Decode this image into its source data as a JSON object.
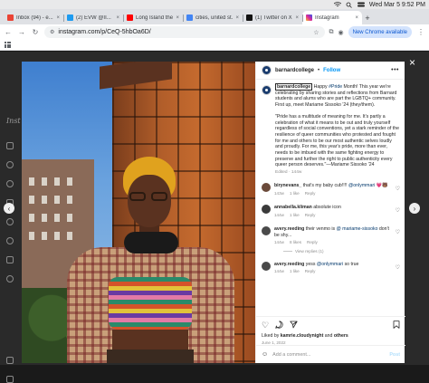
{
  "menubar": {
    "datetime": "Wed Mar 5  9:52 PM"
  },
  "tabs": [
    {
      "label": "Inbox (94) - e...",
      "favicon_color": "#ea4335",
      "active": false
    },
    {
      "label": "(2) EVW @II...",
      "favicon_color": "#1d9bf0",
      "active": false
    },
    {
      "label": "Long Island the...",
      "favicon_color": "#ff0000",
      "active": false
    },
    {
      "label": "cities, united st...",
      "favicon_color": "#4285f4",
      "active": false
    },
    {
      "label": "(1) Twitter on X...",
      "favicon_color": "#111111",
      "active": false
    },
    {
      "label": "Instagram",
      "favicon_color": "#d6249f",
      "active": true
    }
  ],
  "toolbar": {
    "url": "instagram.com/p/CeQ-5hbOa6D/",
    "chrome_available": "New Chrome available"
  },
  "post": {
    "username": "barnardcollege",
    "follow_label": "Follow",
    "caption": {
      "owner": "barnardcollege",
      "text_1a": " Happy ",
      "hashtag": "#Pride",
      "text_1b": " Month! This year we're celebrating by sharing stories and reflections from Barnard students and alums who are part the LGBTQ+ community. First up, meet Mariame Sissoko '24 (they/them).",
      "text_2": "\"Pride has a multitude of meaning for me. It's partly a celebration of what it means to be out and truly yourself regardless of social conventions, yet a stark reminder of the resilience of queer communities who protested and fought for me and others to be our most authentic selves loudly and proudly. For me, this year's pride, more than ever, needs to be imbued with the same fighting energy to preserve and further the right to public authenticity every queer person deserves.\"—Mariame Sissoko '24",
      "meta": "Edited · 144w"
    },
    "comments": [
      {
        "user": "birynevans_",
        "text": " that's my baby cub!!!! ",
        "mention": "@onlymmari",
        "emoji": "💗🐻",
        "age": "143w",
        "likes": "1 like",
        "reply": "Reply",
        "avatar_color": "#6b4a3a"
      },
      {
        "user": "annabella.kliman",
        "text": " absolute icon",
        "mention": "",
        "emoji": "",
        "age": "144w",
        "likes": "1 like",
        "reply": "Reply",
        "avatar_color": "#3a3a3a"
      },
      {
        "user": "avery.reeding",
        "text": " their venmo is ",
        "mention": "@ mariame-sissoko",
        "emoji": "",
        "text_after": " don't be shy...",
        "age": "144w",
        "likes": "8 likes",
        "reply": "Reply",
        "avatar_color": "#4a4a4a",
        "replies": "View replies (1)"
      },
      {
        "user": "avery.reeding",
        "text": " yess ",
        "mention": "@onlymmari",
        "emoji": "",
        "text_after": " so true",
        "age": "144w",
        "likes": "1 like",
        "reply": "Reply",
        "avatar_color": "#4a4a4a"
      }
    ],
    "liked_by_prefix": "Liked by ",
    "liked_by_user": "kamrie.cloudynight",
    "liked_by_suffix": " and ",
    "liked_by_others": "others",
    "date": "June 1, 2022",
    "add_comment_placeholder": "Add a comment...",
    "post_button": "Post"
  },
  "icons": {
    "close": "×",
    "prev": "‹",
    "next": "›",
    "heart": "♡",
    "comment": "◯",
    "share": "➤",
    "save": "⚑",
    "more": "•••",
    "emoji": "☺"
  },
  "ig_logo": "Inst"
}
